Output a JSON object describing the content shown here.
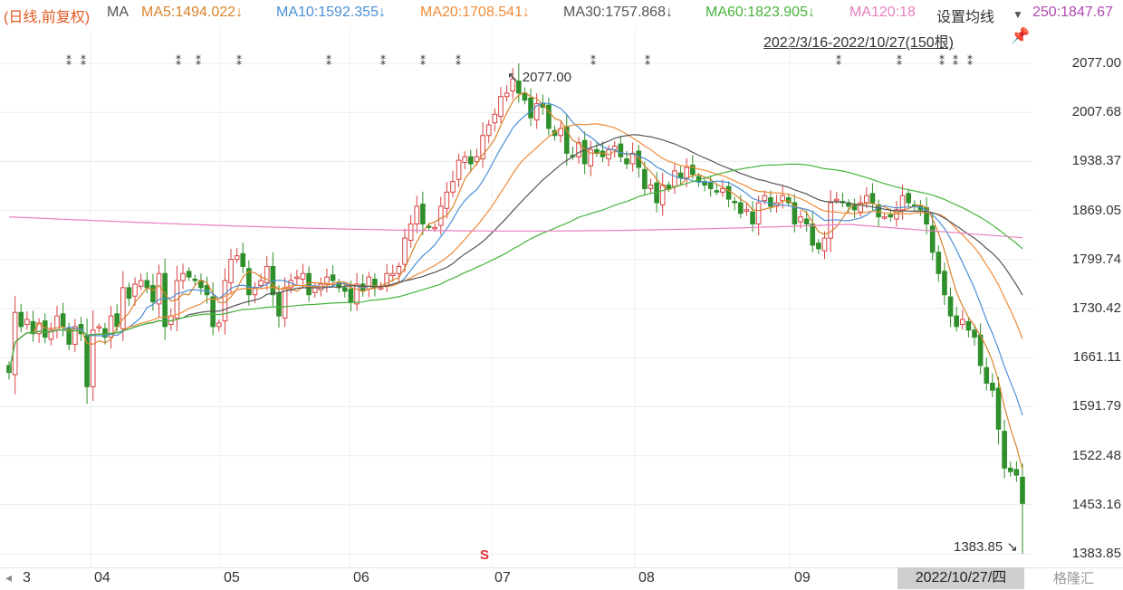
{
  "header": {
    "mode": "(日线,前复权)",
    "ma_label": "MA",
    "ma5": "MA5:1494.022↓",
    "ma10": "MA10:1592.355↓",
    "ma20": "MA20:1708.541↓",
    "ma30": "MA30:1757.868↓",
    "ma60": "MA60:1823.905↓",
    "ma120": "MA120:18",
    "settings": "设置均线",
    "ma250": "250:1847.67",
    "range": "2022/3/16-2022/10/27(150根)"
  },
  "colors": {
    "mode": "#e05a24",
    "ma_label": "#555555",
    "ma5": "#d9822b",
    "ma10": "#4a8fd6",
    "ma20": "#f08c3a",
    "ma30": "#555555",
    "ma60": "#46b43c",
    "ma120": "#e87fbf",
    "ma250": "#b04ab0",
    "up": "#d94040",
    "down": "#2f8f2a"
  },
  "x_axis": {
    "left_arrow": "◂",
    "first": "3",
    "months": [
      "04",
      "05",
      "06",
      "07",
      "08",
      "09"
    ],
    "current_date": "2022/10/27/四"
  },
  "high_label": "2077.00",
  "low_label": "1383.85",
  "s_mark": "S",
  "watermark": "格隆汇",
  "chart_data": {
    "type": "candlestick",
    "y_ticks": [
      "2077.00",
      "2007.68",
      "1938.37",
      "1869.05",
      "1799.74",
      "1730.42",
      "1661.11",
      "1591.79",
      "1522.48",
      "1453.16",
      "1383.85"
    ],
    "ylim": [
      1383.85,
      2077.0
    ],
    "x_months": [
      "3",
      "04",
      "05",
      "06",
      "07",
      "08",
      "09",
      "10"
    ],
    "annotations": {
      "max": 2077.0,
      "min": 1383.85
    },
    "series": {
      "close": [
        1640,
        1725,
        1705,
        1715,
        1695,
        1710,
        1690,
        1700,
        1720,
        1705,
        1680,
        1705,
        1695,
        1620,
        1700,
        1705,
        1690,
        1720,
        1705,
        1760,
        1745,
        1765,
        1770,
        1760,
        1740,
        1780,
        1705,
        1720,
        1770,
        1780,
        1775,
        1770,
        1760,
        1750,
        1705,
        1710,
        1770,
        1800,
        1805,
        1790,
        1750,
        1760,
        1770,
        1790,
        1750,
        1720,
        1760,
        1770,
        1775,
        1780,
        1750,
        1760,
        1765,
        1775,
        1770,
        1760,
        1755,
        1740,
        1765,
        1755,
        1775,
        1760,
        1760,
        1780,
        1780,
        1790,
        1830,
        1850,
        1875,
        1850,
        1845,
        1845,
        1875,
        1895,
        1910,
        1940,
        1945,
        1935,
        1945,
        1975,
        1990,
        2005,
        2030,
        2035,
        2055,
        2035,
        2025,
        2000,
        2020,
        2015,
        1985,
        1975,
        1985,
        1950,
        1945,
        1965,
        1935,
        1955,
        1950,
        1945,
        1955,
        1960,
        1945,
        1935,
        1950,
        1930,
        1900,
        1905,
        1880,
        1905,
        1900,
        1925,
        1915,
        1930,
        1920,
        1910,
        1905,
        1900,
        1895,
        1900,
        1885,
        1880,
        1865,
        1870,
        1850,
        1880,
        1890,
        1875,
        1880,
        1890,
        1880,
        1850,
        1860,
        1850,
        1820,
        1815,
        1830,
        1880,
        1885,
        1880,
        1875,
        1870,
        1880,
        1890,
        1880,
        1860,
        1860,
        1860,
        1870,
        1890,
        1880,
        1875,
        1870,
        1850,
        1810,
        1780,
        1750,
        1720,
        1705,
        1715,
        1700,
        1690,
        1650,
        1625,
        1615,
        1560,
        1505,
        1500,
        1495,
        1455
      ]
    }
  }
}
